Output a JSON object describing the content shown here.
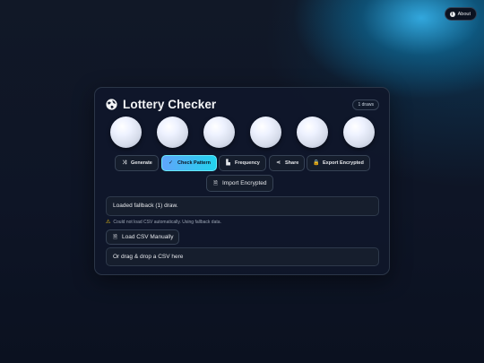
{
  "about": {
    "label": "About",
    "icon": "info-icon"
  },
  "app": {
    "title": "Lottery Checker",
    "icon": "globe-icon"
  },
  "draws_badge": "1 draws",
  "balls": [
    {
      "number": ""
    },
    {
      "number": ""
    },
    {
      "number": ""
    },
    {
      "number": ""
    },
    {
      "number": ""
    },
    {
      "number": ""
    }
  ],
  "toolbar": {
    "generate": {
      "label": "Generate",
      "icon": "shuffle-icon"
    },
    "check_pattern": {
      "label": "Check Pattern",
      "icon": "check-icon"
    },
    "frequency": {
      "label": "Frequency",
      "icon": "bar-chart-icon"
    },
    "share": {
      "label": "Share",
      "icon": "share-icon"
    },
    "export_encrypted": {
      "label": "Export Encrypted",
      "icon": "lock-icon"
    },
    "import_encrypted": {
      "label": "Import Encrypted",
      "icon": "file-icon"
    }
  },
  "status_message": "Loaded fallback (1) draw.",
  "warning_message": "Could not load CSV automatically. Using fallback data.",
  "load_csv": {
    "label": "Load CSV Manually",
    "icon": "file-icon"
  },
  "drop_zone": "Or drag & drop a CSV here",
  "colors": {
    "background": "#0e1526",
    "card": "#0f172a",
    "accent_gradient_start": "#60a5fa",
    "accent_gradient_end": "#22d3ee",
    "glow": "#38bdf8",
    "warning": "#facc15"
  }
}
